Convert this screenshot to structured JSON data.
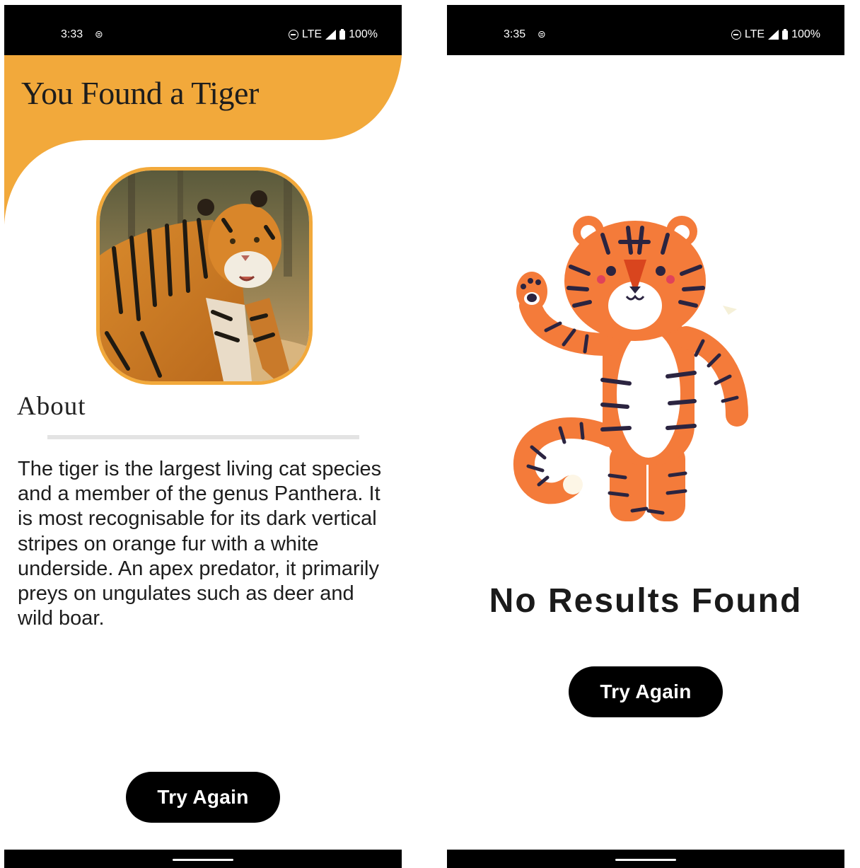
{
  "left_screen": {
    "status_bar": {
      "time": "3:33",
      "network": "LTE",
      "battery": "100%"
    },
    "title": "You Found a Tiger",
    "photo_alt": "tiger photo",
    "about_heading": "About",
    "about_text": "The tiger is the largest living cat species and a member of the genus Panthera. It is most recognisable for its dark vertical stripes on orange fur with a white underside. An apex predator, it primarily preys on ungulates such as deer and wild boar.",
    "try_again_label": "Try Again"
  },
  "right_screen": {
    "status_bar": {
      "time": "3:35",
      "network": "LTE",
      "battery": "100%"
    },
    "message": "No Results Found",
    "try_again_label": "Try Again"
  },
  "colors": {
    "accent": "#f2a93b",
    "status_bar": "#000000",
    "button": "#000000",
    "tiger_orange": "#f47b3a",
    "stripe": "#2b2440"
  },
  "icons": [
    "do-not-disturb-icon",
    "sync-icon",
    "signal-icon",
    "battery-icon"
  ]
}
